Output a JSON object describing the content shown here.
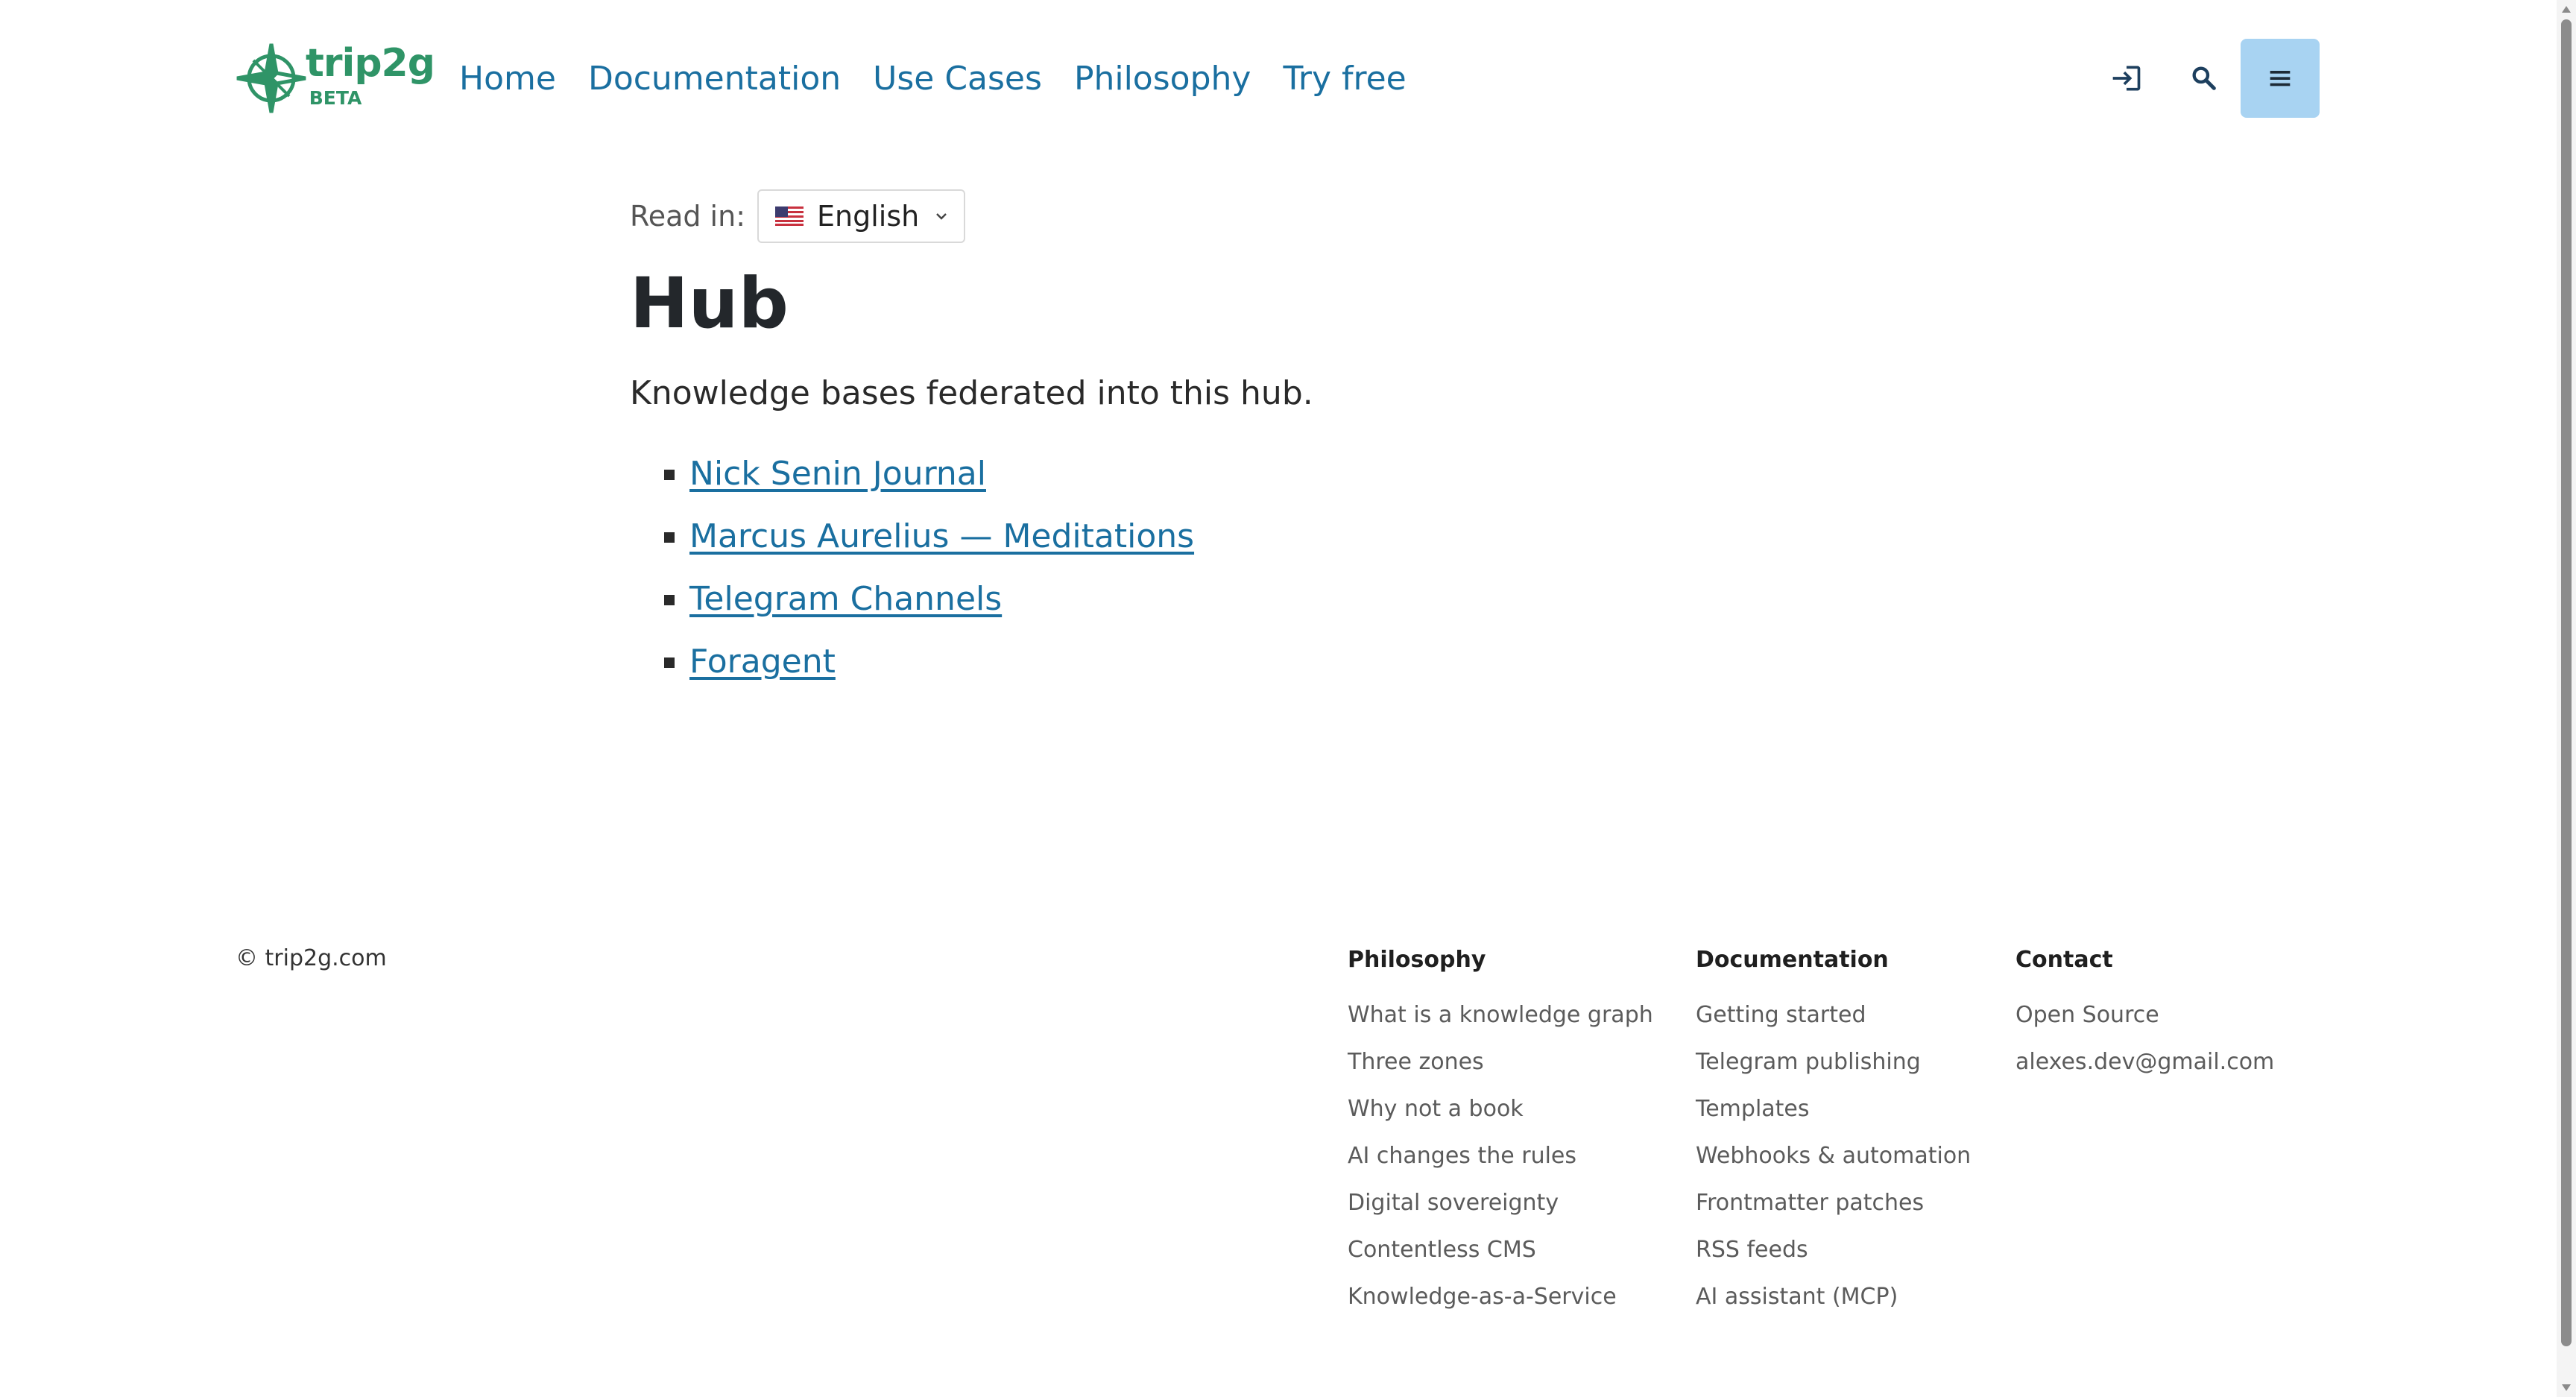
{
  "header": {
    "logo_text": "trip2g",
    "logo_badge": "BETA",
    "nav": [
      {
        "label": "Home"
      },
      {
        "label": "Documentation"
      },
      {
        "label": "Use Cases"
      },
      {
        "label": "Philosophy"
      },
      {
        "label": "Try free"
      }
    ],
    "icons": {
      "login": "login-icon",
      "search": "search-icon",
      "menu": "hamburger-menu-icon"
    },
    "menu_button_color": "#a8d3f2",
    "link_color": "#1a6fa0",
    "logo_color": "#2f9467"
  },
  "language": {
    "label": "Read in:",
    "selected": "English",
    "flag": "us-flag-icon"
  },
  "main": {
    "title": "Hub",
    "lead": "Knowledge bases federated into this hub.",
    "items": [
      {
        "label": "Nick Senin Journal"
      },
      {
        "label": "Marcus Aurelius — Meditations"
      },
      {
        "label": "Telegram Channels"
      },
      {
        "label": "Foragent"
      }
    ]
  },
  "footer": {
    "copyright": "© trip2g.com",
    "columns": [
      {
        "heading": "Philosophy",
        "links": [
          "What is a knowledge graph",
          "Three zones",
          "Why not a book",
          "AI changes the rules",
          "Digital sovereignty",
          "Contentless CMS",
          "Knowledge-as-a-Service"
        ]
      },
      {
        "heading": "Documentation",
        "links": [
          "Getting started",
          "Telegram publishing",
          "Templates",
          "Webhooks & automation",
          "Frontmatter patches",
          "RSS feeds",
          "AI assistant (MCP)"
        ]
      },
      {
        "heading": "Contact",
        "links": [
          "Open Source",
          "alexes.dev@gmail.com"
        ]
      }
    ]
  }
}
